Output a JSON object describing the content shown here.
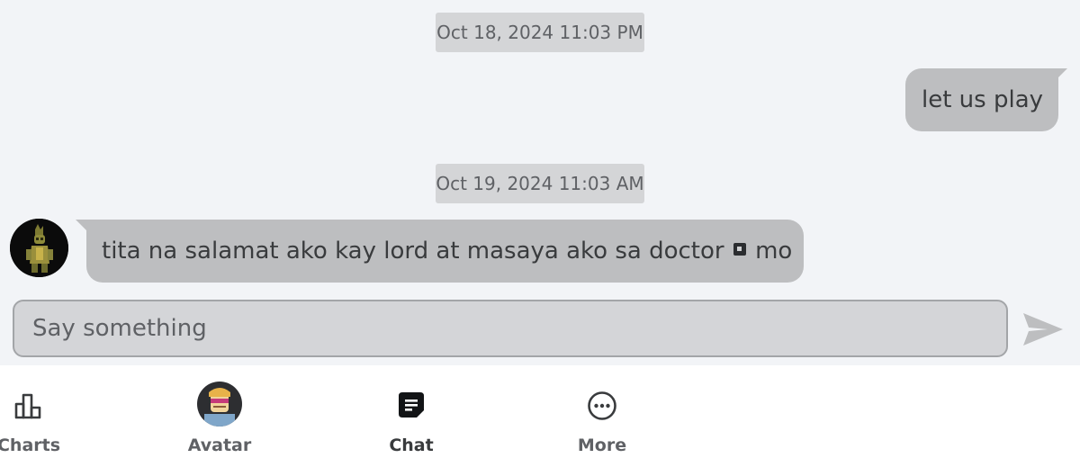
{
  "messages": [
    {
      "timestamp": "Oct 18, 2024 11:03 PM",
      "direction": "outgoing",
      "text": "let us play"
    },
    {
      "timestamp": "Oct 19, 2024 11:03 AM",
      "direction": "incoming",
      "text_before_glyph": "tita na salamat ako kay lord at masaya ako sa doctor",
      "text_after_glyph": "mo"
    }
  ],
  "composer": {
    "placeholder": "Say something",
    "value": ""
  },
  "nav": {
    "items": [
      {
        "label": "Charts",
        "icon": "charts-icon"
      },
      {
        "label": "Avatar",
        "icon": "avatar-thumbnail"
      },
      {
        "label": "Chat",
        "icon": "chat-icon",
        "active": true
      },
      {
        "label": "More",
        "icon": "more-icon"
      }
    ]
  },
  "colors": {
    "background": "#f2f4f7",
    "bubble": "#bdbec0",
    "timestamp_pill": "#d4d5d7",
    "nav_background": "#ffffff",
    "active_label": "#393b3d",
    "inactive_label": "#5f6165"
  }
}
